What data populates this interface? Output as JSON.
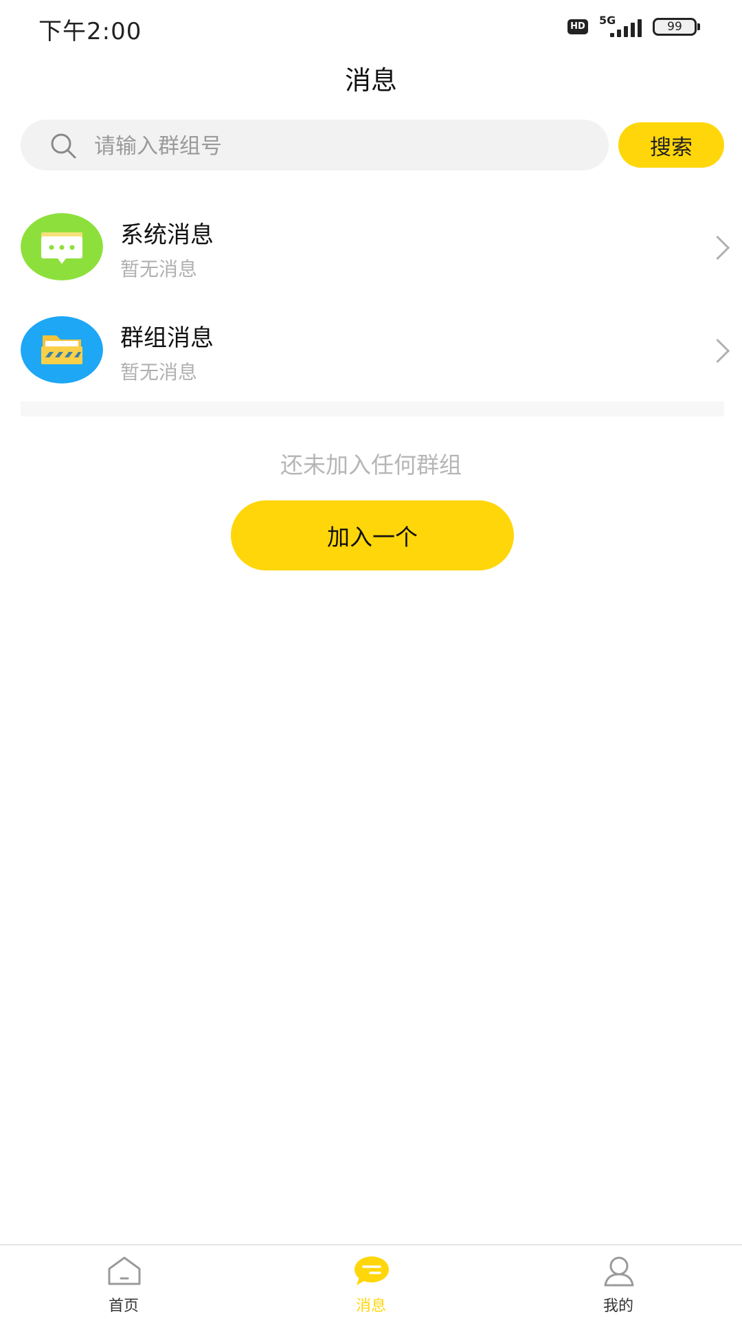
{
  "status_bar": {
    "time": "下午2:00",
    "hd": "HD",
    "network": "5G",
    "battery": "99"
  },
  "header": {
    "title": "消息"
  },
  "search": {
    "placeholder": "请输入群组号",
    "button_label": "搜索"
  },
  "messages": [
    {
      "title": "系统消息",
      "subtitle": "暂无消息",
      "icon": "system-message-icon",
      "color": "#8DE03C"
    },
    {
      "title": "群组消息",
      "subtitle": "暂无消息",
      "icon": "group-folder-icon",
      "color": "#1EA7F5"
    }
  ],
  "empty_state": {
    "text": "还未加入任何群组",
    "button_label": "加入一个"
  },
  "bottom_nav": [
    {
      "label": "首页",
      "icon": "home-icon",
      "active": false
    },
    {
      "label": "消息",
      "icon": "message-icon",
      "active": true
    },
    {
      "label": "我的",
      "icon": "profile-icon",
      "active": false
    }
  ],
  "colors": {
    "accent": "#FFD60A",
    "muted": "#B0B0B0"
  }
}
